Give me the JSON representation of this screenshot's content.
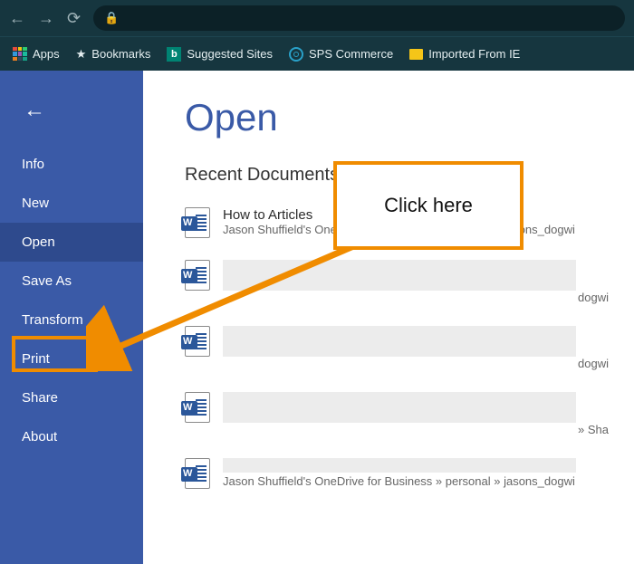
{
  "browser": {
    "bookmarks": {
      "apps": "Apps",
      "bookmarks": "Bookmarks",
      "suggested": "Suggested Sites",
      "sps": "SPS Commerce",
      "imported": "Imported From IE"
    }
  },
  "sidebar": {
    "items": [
      {
        "label": "Info"
      },
      {
        "label": "New"
      },
      {
        "label": "Open"
      },
      {
        "label": "Save As"
      },
      {
        "label": "Transform"
      },
      {
        "label": "Print"
      },
      {
        "label": "Share"
      },
      {
        "label": "About"
      }
    ]
  },
  "main": {
    "title": "Open",
    "section": "Recent Documents",
    "docs": [
      {
        "name": "How to Articles",
        "path": "Jason Shuffield's OneDrive for Business » personal » jasons_dogwi"
      },
      {
        "name": "",
        "path": "dogwi"
      },
      {
        "name": "",
        "path": "dogwi"
      },
      {
        "name": "",
        "path": "» Sha"
      },
      {
        "name": "",
        "path": "Jason Shuffield's OneDrive for Business » personal » jasons_dogwi"
      }
    ]
  },
  "annotation": {
    "callout": "Click here"
  }
}
